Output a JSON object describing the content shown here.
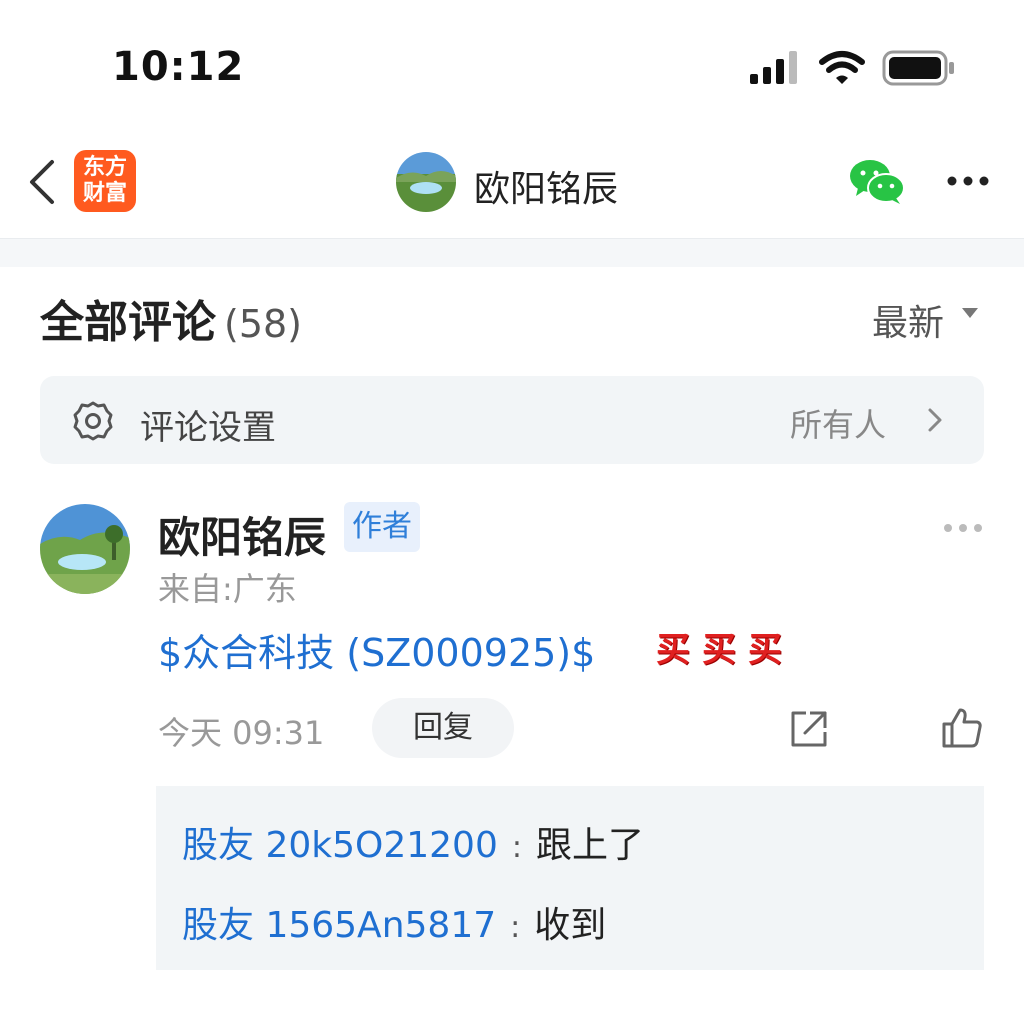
{
  "status_bar": {
    "time": "10:12"
  },
  "nav": {
    "logo_line1": "东方",
    "logo_line2": "财富",
    "title": "欧阳铭辰",
    "more_label": "•••"
  },
  "comments_header": {
    "title": "全部评论",
    "count": "(58)",
    "sort_label": "最新"
  },
  "settings": {
    "label": "评论设置",
    "value": "所有人"
  },
  "comment": {
    "author": "欧阳铭辰",
    "badge": "作者",
    "location": "来自:广东",
    "stock_tag": "$众合科技 (SZ000925)$",
    "emojis": "买买买",
    "time": "今天 09:31",
    "reply_label": "回复"
  },
  "replies": [
    {
      "user": "股友 20k5O21200",
      "colon": ":",
      "text": "跟上了"
    },
    {
      "user": "股友 1565An5817",
      "colon": ":",
      "text": "收到"
    }
  ],
  "colors": {
    "brand": "#ff5a1f",
    "link": "#1f6fd1",
    "wechat": "#28c445"
  }
}
